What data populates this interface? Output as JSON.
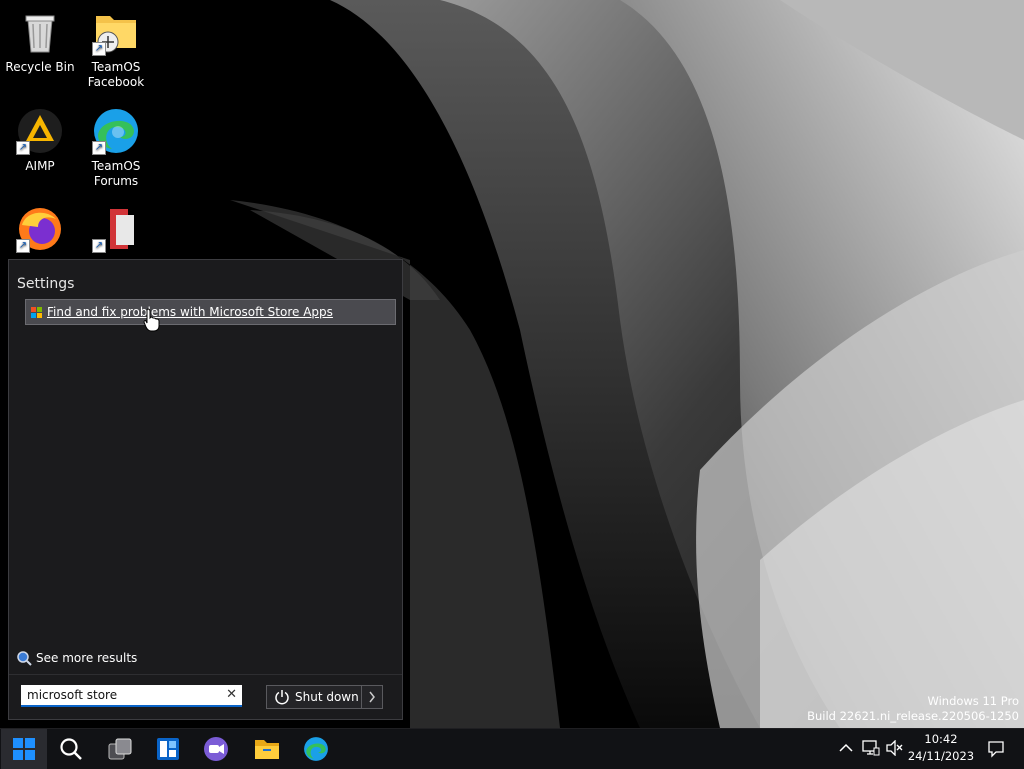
{
  "desktop": {
    "icons": [
      {
        "label": "Recycle Bin",
        "icon": "recycle-bin-icon"
      },
      {
        "label": "TeamOS\nFacebook",
        "icon": "folder-shortcut-icon"
      },
      {
        "label": "AIMP",
        "icon": "aimp-icon"
      },
      {
        "label": "TeamOS\nForums",
        "icon": "edge-icon"
      },
      {
        "label": "",
        "icon": "firefox-icon"
      },
      {
        "label": "",
        "icon": "document-app-icon"
      }
    ]
  },
  "start_panel": {
    "heading": "Settings",
    "result": {
      "label": "Find and fix problems with Microsoft Store Apps",
      "icon": "store-troubleshoot-icon"
    },
    "see_more": "See more results",
    "search": {
      "value": "microsoft store",
      "clear_icon": "close-icon"
    },
    "shutdown": {
      "label": "Shut down",
      "icon": "power-icon",
      "arrow_icon": "chevron-right-icon"
    }
  },
  "watermark": {
    "line1": "Windows 11 Pro",
    "line2": "Build 22621.ni_release.220506-1250"
  },
  "taskbar": {
    "buttons": [
      "start-icon",
      "search-icon",
      "task-view-icon",
      "widgets-icon",
      "chat-icon",
      "file-explorer-icon",
      "edge-icon"
    ],
    "tray": [
      "chevron-up-icon",
      "network-icon",
      "volume-muted-icon"
    ],
    "time": "10:42",
    "date": "24/11/2023",
    "notification_icon": "notification-icon"
  },
  "colors": {
    "accent": "#0a64c8",
    "panel_bg": "#1b1b1d",
    "taskbar_bg": "#111215"
  }
}
